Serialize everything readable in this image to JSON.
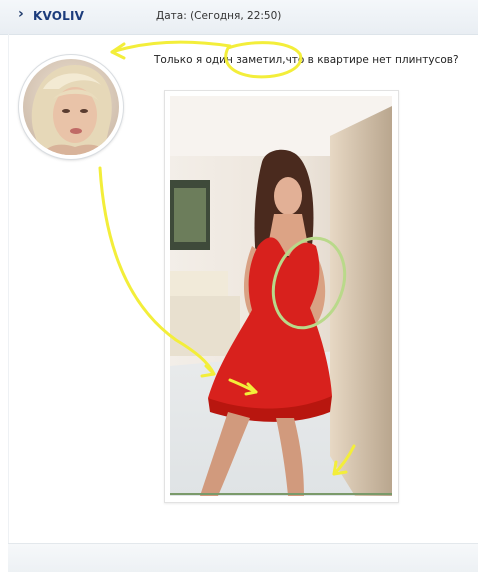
{
  "post": {
    "author": "KVOLIV",
    "date": "Дата: (Сегодня, 22:50)",
    "message": "Только я один заметил,что в квартире нет плинтусов?"
  },
  "colors": {
    "author": "#1c3c7c",
    "annotation": "#f3ee3a",
    "dress": "#d8211d"
  }
}
